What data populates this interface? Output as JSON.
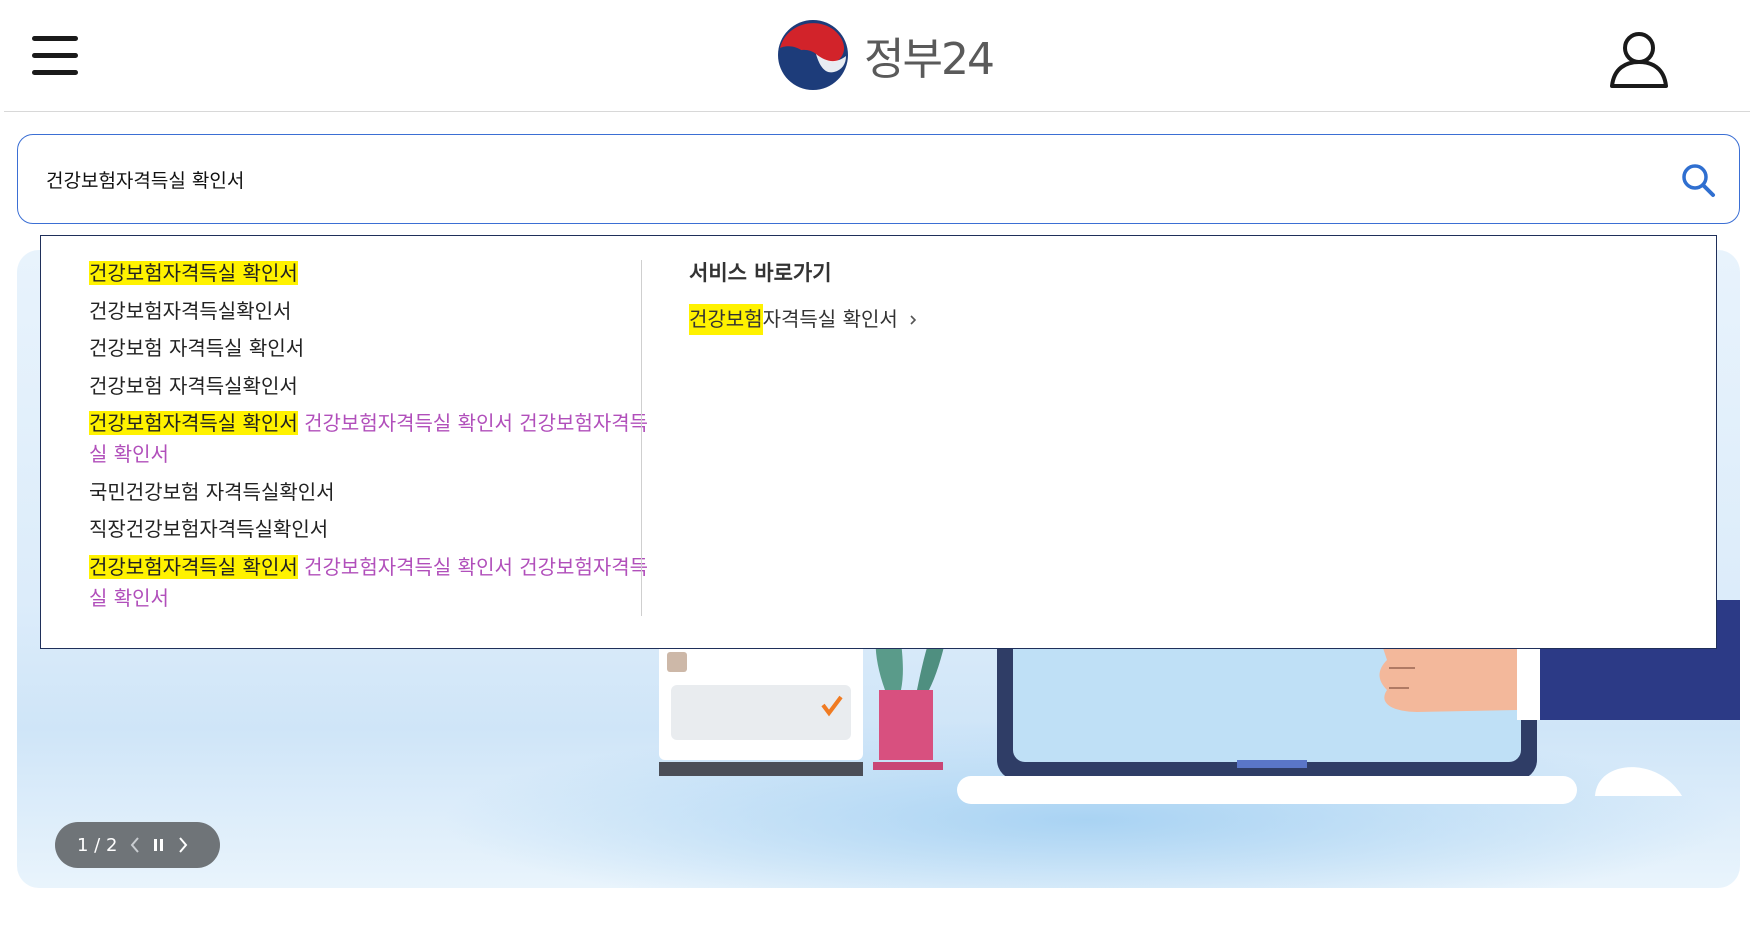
{
  "header": {
    "logo_text": "정부24",
    "menu_icon": "hamburger-menu-icon",
    "user_icon": "user-icon",
    "colors": {
      "logo_blue": "#1d3c7a",
      "logo_red": "#d2232a",
      "logo_text": "#5a5a5a"
    }
  },
  "search": {
    "value": "건강보험자격득실 확인서",
    "icon": "search-icon",
    "border_color": "#3b6fd4"
  },
  "dropdown": {
    "suggestions": [
      {
        "highlight": "건강보험자격득실 확인서",
        "text": "",
        "extra": ""
      },
      {
        "highlight": "",
        "text": "건강보험자격득실확인서",
        "extra": ""
      },
      {
        "highlight": "",
        "text": "건강보험 자격득실 확인서",
        "extra": ""
      },
      {
        "highlight": "",
        "text": "건강보험 자격득실확인서",
        "extra": ""
      },
      {
        "highlight": "건강보험자격득실 확인서",
        "text": "",
        "extra": " 건강보험자격득실 확인서 건강보험자격득실 확인서"
      },
      {
        "highlight": "",
        "text": "국민건강보험 자격득실확인서",
        "extra": ""
      },
      {
        "highlight": "",
        "text": "직장건강보험자격득실확인서",
        "extra": ""
      },
      {
        "highlight": "건강보험자격득실 확인서",
        "text": "",
        "extra": " 건강보험자격득실 확인서 건강보험자격득실 확인서"
      }
    ],
    "service_title": "서비스 바로가기",
    "service_link": {
      "highlight": "건강보험",
      "text": " 자격득실 확인서"
    },
    "colors": {
      "highlight": "#fff200",
      "extra_text": "#b14fbb",
      "border": "#1f2f5a"
    }
  },
  "banner": {
    "slide_counter": "1 / 2",
    "prev_icon": "chevron-left-icon",
    "pause_icon": "pause-icon",
    "next_icon": "chevron-right-icon"
  }
}
